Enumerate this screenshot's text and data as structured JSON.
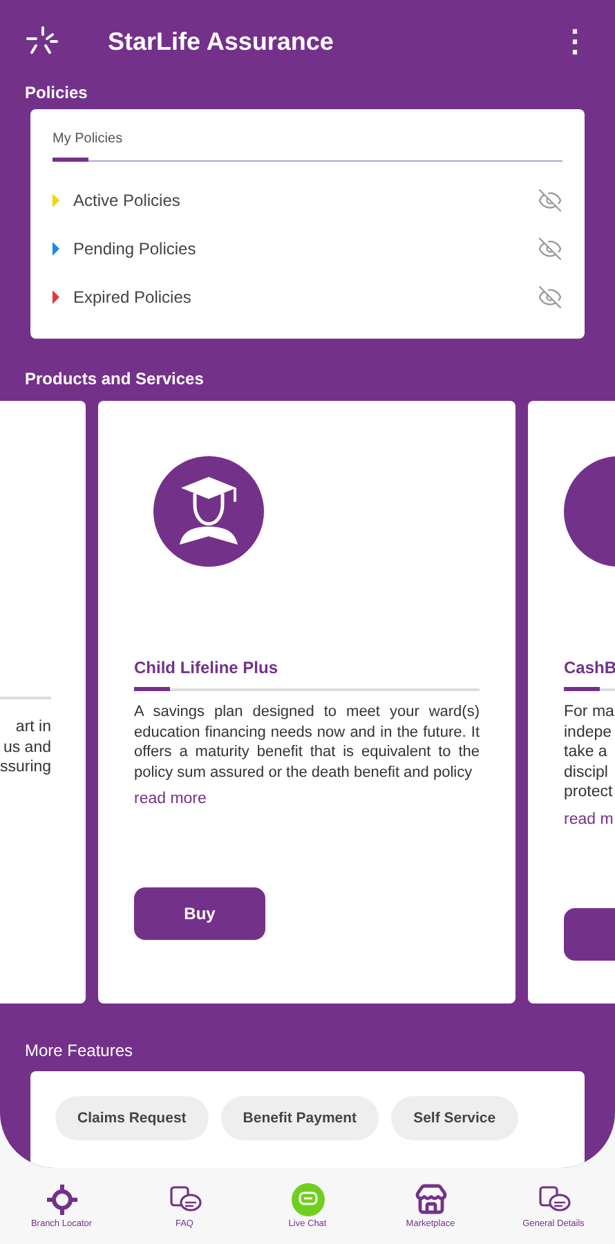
{
  "app_bar": {
    "title": "StarLife Assurance",
    "menu_glyph": "⋮"
  },
  "policies": {
    "heading": "Policies",
    "tabs": [
      {
        "label": "My Policies",
        "selected": true
      }
    ],
    "items": [
      {
        "label": "Active Policies",
        "color": "#f2d600"
      },
      {
        "label": "Pending Policies",
        "color": "#1e88e5"
      },
      {
        "label": "Expired Policies",
        "color": "#e53935"
      }
    ]
  },
  "products": {
    "heading": "Products and Services",
    "cards": [
      {
        "kind": "left-partial",
        "lines": [
          "art in",
          "us and",
          "ssuring"
        ]
      },
      {
        "kind": "full",
        "title": "Child Lifeline Plus",
        "description": "A savings plan designed to meet your ward(s) education financing needs now and in the future. It offers a maturity benefit that is equivalent to the policy sum assured or the death benefit and policy",
        "link": "read more",
        "button": "Buy"
      },
      {
        "kind": "right-partial",
        "title": "CashB",
        "lines": [
          "For ma",
          "indepe",
          "take a",
          "discipl",
          "protect"
        ],
        "link": "read m"
      }
    ]
  },
  "more_features": {
    "heading": "More Features",
    "chips": [
      "Claims Request",
      "Benefit Payment",
      "Self Service"
    ]
  },
  "bottom_nav": [
    {
      "label": "Branch Locator",
      "kind": "locator"
    },
    {
      "label": "FAQ",
      "kind": "chat"
    },
    {
      "label": "Live Chat",
      "kind": "live"
    },
    {
      "label": "Marketplace",
      "kind": "store"
    },
    {
      "label": "General Details",
      "kind": "chat"
    }
  ]
}
